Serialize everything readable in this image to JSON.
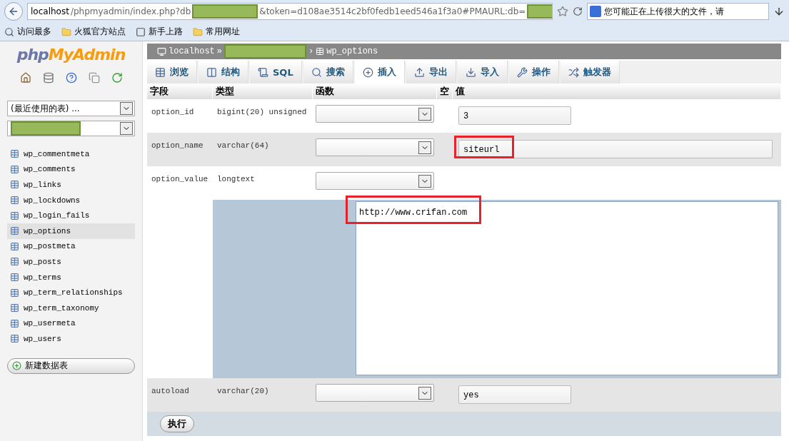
{
  "browser": {
    "url_parts": [
      {
        "kind": "host",
        "text": "localhost"
      },
      {
        "kind": "text",
        "text": "/phpmyadmin/index.php?db"
      },
      {
        "kind": "redacted"
      },
      {
        "kind": "text",
        "text": "&token=d108ae3514c2bf0fedb1eed546a1f3a0#PMAURL:db="
      },
      {
        "kind": "redacted"
      }
    ],
    "search_text": "您可能正在上传很大的文件，请",
    "bookmarks": [
      {
        "label": "访问最多",
        "kind": "search"
      },
      {
        "label": "火狐官方站点",
        "kind": "folder"
      },
      {
        "label": "新手上路",
        "kind": "dashed"
      },
      {
        "label": "常用网址",
        "kind": "folder"
      }
    ]
  },
  "sidebar": {
    "logo_php": "php",
    "logo_admin": "MyAdmin",
    "recent_select": "(最近使用的表) ...",
    "tables": [
      {
        "name": "wp_commentmeta",
        "selected": false
      },
      {
        "name": "wp_comments",
        "selected": false
      },
      {
        "name": "wp_links",
        "selected": false
      },
      {
        "name": "wp_lockdowns",
        "selected": false
      },
      {
        "name": "wp_login_fails",
        "selected": false
      },
      {
        "name": "wp_options",
        "selected": true
      },
      {
        "name": "wp_postmeta",
        "selected": false
      },
      {
        "name": "wp_posts",
        "selected": false
      },
      {
        "name": "wp_terms",
        "selected": false
      },
      {
        "name": "wp_term_relationships",
        "selected": false
      },
      {
        "name": "wp_term_taxonomy",
        "selected": false
      },
      {
        "name": "wp_usermeta",
        "selected": false
      },
      {
        "name": "wp_users",
        "selected": false
      }
    ],
    "new_table_button": "新建数据表"
  },
  "breadcrumb": {
    "server": "localhost",
    "separator": "»",
    "arrow": "›",
    "table": "wp_options"
  },
  "tabs": [
    {
      "label": "浏览",
      "selected": false
    },
    {
      "label": "结构",
      "selected": false
    },
    {
      "label": "SQL",
      "selected": false
    },
    {
      "label": "搜索",
      "selected": false
    },
    {
      "label": "插入",
      "selected": true
    },
    {
      "label": "导出",
      "selected": false
    },
    {
      "label": "导入",
      "selected": false
    },
    {
      "label": "操作",
      "selected": false
    },
    {
      "label": "触发器",
      "selected": false
    }
  ],
  "columns": [
    "字段",
    "类型",
    "函数",
    "空",
    "值"
  ],
  "rows": [
    {
      "field": "option_id",
      "type": "bigint(20) unsigned",
      "kind": "input",
      "value": "3",
      "highlighted": false,
      "shaded": false,
      "wide": false
    },
    {
      "field": "option_name",
      "type": "varchar(64)",
      "kind": "input",
      "value": "siteurl",
      "highlighted": true,
      "shaded": true,
      "wide": true
    },
    {
      "field": "option_value",
      "type": "longtext",
      "kind": "textarea",
      "value": "http://www.crifan.com",
      "highlighted": true,
      "shaded": false
    },
    {
      "field": "autoload",
      "type": "varchar(20)",
      "kind": "input",
      "value": "yes",
      "highlighted": false,
      "shaded": true,
      "wide": false
    }
  ],
  "submit_button": "执行"
}
